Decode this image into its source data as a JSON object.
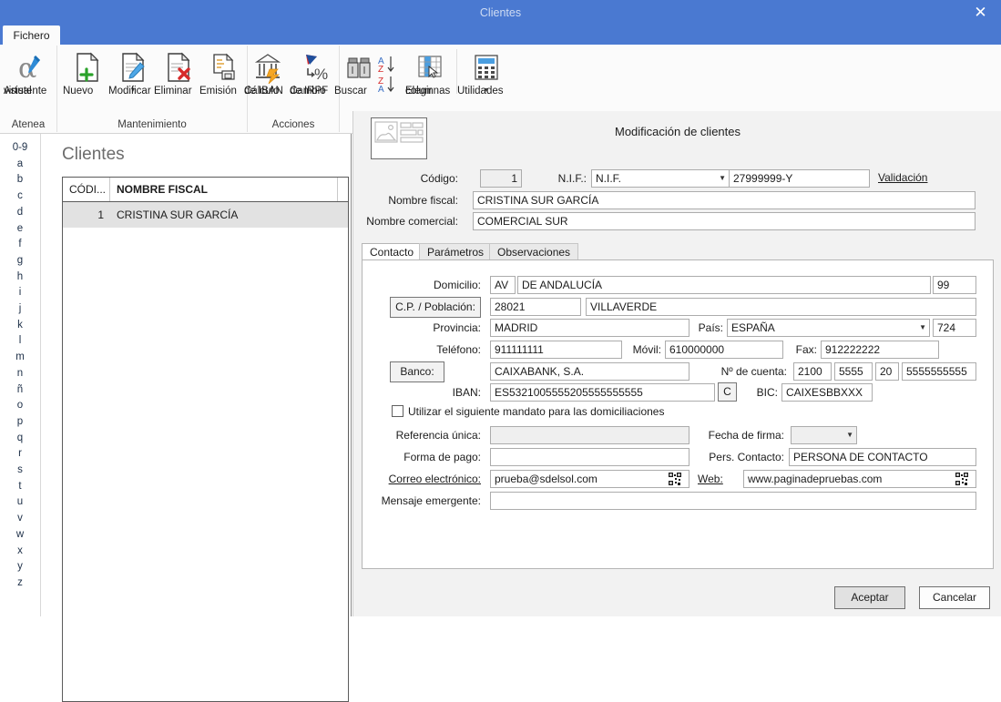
{
  "window": {
    "title": "Clientes",
    "close_label": "✕"
  },
  "ribbon": {
    "file_tab": "Fichero",
    "groups": [
      {
        "name": "Atenea",
        "buttons": [
          {
            "label_line1": "Asistente",
            "label_line2": "virtual",
            "icon": "alpha-pen-icon",
            "caret": false
          }
        ]
      },
      {
        "name": "Mantenimiento",
        "buttons": [
          {
            "label_line1": "Nuevo",
            "label_line2": "",
            "icon": "document-plus-icon",
            "caret": false
          },
          {
            "label_line1": "Modificar",
            "label_line2": "",
            "icon": "document-pencil-icon",
            "caret": true
          },
          {
            "label_line1": "Eliminar",
            "label_line2": "",
            "icon": "document-delete-icon",
            "caret": false
          },
          {
            "label_line1": "Emisión",
            "label_line2": "",
            "icon": "document-print-icon",
            "caret": false
          }
        ]
      },
      {
        "name": "Acciones",
        "buttons": [
          {
            "label_line1": "Cálculo",
            "label_line2": "de IBAN",
            "icon": "bank-bolt-icon",
            "caret": false
          },
          {
            "label_line1": "Cambio",
            "label_line2": "de IRPF",
            "icon": "percent-arrow-icon",
            "caret": false
          }
        ]
      },
      {
        "name": "",
        "buttons": [
          {
            "label_line1": "Buscar",
            "label_line2": "",
            "icon": "binoculars-icon",
            "caret": false
          },
          {
            "label_line1": "",
            "label_line2": "",
            "icon": "sort-az-za-icon",
            "caret": false
          },
          {
            "label_line1": "Elegir",
            "label_line2": "columnas",
            "icon": "choose-columns-icon",
            "caret": false
          },
          {
            "label_line1": "Utilidades",
            "label_line2": "",
            "icon": "calculator-icon",
            "caret": true
          }
        ]
      }
    ]
  },
  "alpha_rail": {
    "items": [
      "0-9",
      "a",
      "b",
      "c",
      "d",
      "e",
      "f",
      "g",
      "h",
      "i",
      "j",
      "k",
      "l",
      "m",
      "n",
      "ñ",
      "o",
      "p",
      "q",
      "r",
      "s",
      "t",
      "u",
      "v",
      "w",
      "x",
      "y",
      "z"
    ]
  },
  "list_panel": {
    "title": "Clientes",
    "columns": [
      "CÓDI...",
      "NOMBRE FISCAL",
      ""
    ],
    "rows": [
      {
        "codigo": "1",
        "nombre_fiscal": "CRISTINA SUR GARCÍA"
      }
    ]
  },
  "splitter": {
    "arrow": "❯"
  },
  "dialog": {
    "title": "Modificación de clientes",
    "icon": "form-preview-icon",
    "header": {
      "codigo_label": "Código:",
      "codigo_value": "1",
      "nif_label": "N.I.F.:",
      "nif_type_value": "N.I.F.",
      "nif_value": "27999999-Y",
      "validacion_link": "Validación",
      "nombre_fiscal_label": "Nombre fiscal:",
      "nombre_fiscal_value": "CRISTINA SUR GARCÍA",
      "nombre_comercial_label": "Nombre comercial:",
      "nombre_comercial_value": "COMERCIAL SUR"
    },
    "tabs": [
      {
        "label": "Contacto",
        "active": true
      },
      {
        "label": "Parámetros",
        "active": false
      },
      {
        "label": "Observaciones",
        "active": false
      }
    ],
    "contacto": {
      "domicilio_label": "Domicilio:",
      "domicilio_tipo": "AV",
      "domicilio_via": "DE ANDALUCÍA",
      "domicilio_num": "99",
      "cp_poblacion_button": "C.P. / Población:",
      "cp_value": "28021",
      "poblacion_value": "VILLAVERDE",
      "provincia_label": "Provincia:",
      "provincia_value": "MADRID",
      "pais_label": "País:",
      "pais_value": "ESPAÑA",
      "pais_code": "724",
      "telefono_label": "Teléfono:",
      "telefono_value": "911111111",
      "movil_label": "Móvil:",
      "movil_value": "610000000",
      "fax_label": "Fax:",
      "fax_value": "912222222",
      "banco_button": "Banco:",
      "banco_value": "CAIXABANK, S.A.",
      "cuenta_label": "Nº de cuenta:",
      "cuenta_entidad": "2100",
      "cuenta_oficina": "5555",
      "cuenta_dc": "20",
      "cuenta_numero": "5555555555",
      "iban_label": "IBAN:",
      "iban_value": "ES5321005555205555555555",
      "iban_check_button": "C",
      "bic_label": "BIC:",
      "bic_value": "CAIXESBBXXX",
      "mandato_checkbox_label": "Utilizar el siguiente mandato para las domiciliaciones",
      "mandato_checked": false,
      "referencia_label": "Referencia única:",
      "referencia_value": "",
      "fecha_firma_label": "Fecha de firma:",
      "fecha_firma_value": "",
      "forma_pago_label": "Forma de pago:",
      "forma_pago_value": "",
      "pers_contacto_label": "Pers. Contacto:",
      "pers_contacto_value": "PERSONA DE CONTACTO",
      "correo_label": "Correo electrónico:",
      "correo_value": "prueba@sdelsol.com",
      "web_label": "Web:",
      "web_value": "www.paginadepruebas.com",
      "mensaje_label": "Mensaje emergente:",
      "mensaje_value": ""
    },
    "footer": {
      "accept_label": "Aceptar",
      "cancel_label": "Cancelar"
    }
  },
  "colors": {
    "titlebar": "#4a79d1",
    "ribbon_bg": "#fbfbfb",
    "dialog_bg": "#f2f2f2",
    "row_selected": "#e2e2e2",
    "accent_green": "#2aa22a",
    "accent_red": "#d62c2c",
    "accent_blue": "#2e8bd6"
  }
}
